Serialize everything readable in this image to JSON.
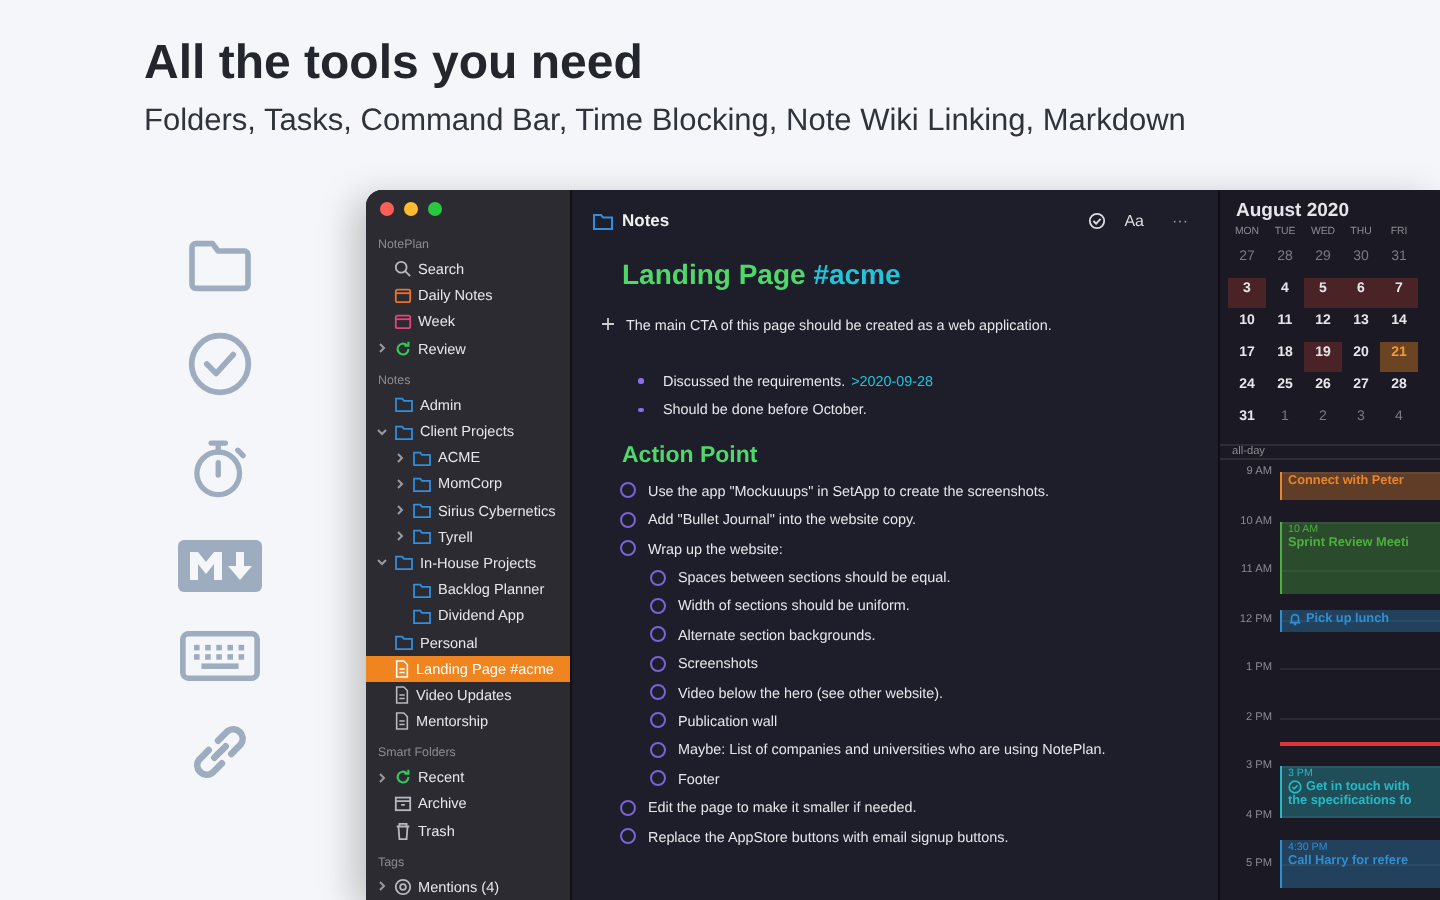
{
  "headline": "All the tools you need",
  "subheadline": "Folders, Tasks, Command Bar, Time Blocking, Note Wiki Linking, Markdown",
  "sidebar": {
    "sections": [
      {
        "title": "NotePlan",
        "items": [
          {
            "label": "Search",
            "kind": "search",
            "selected": false
          },
          {
            "label": "Daily Notes",
            "kind": "daily",
            "selected": false
          },
          {
            "label": "Week",
            "kind": "week",
            "selected": false
          },
          {
            "label": "Review",
            "kind": "review",
            "selected": false,
            "expanded": false
          }
        ]
      },
      {
        "title": "Notes",
        "items": [
          {
            "label": "Admin",
            "kind": "folder",
            "selected": false
          },
          {
            "label": "Client Projects",
            "kind": "folder",
            "selected": false,
            "expanded": true,
            "children": [
              {
                "label": "ACME",
                "kind": "folder",
                "selected": false,
                "expanded": false
              },
              {
                "label": "MomCorp",
                "kind": "folder",
                "selected": false,
                "expanded": false
              },
              {
                "label": "Sirius Cybernetics",
                "kind": "folder",
                "selected": false,
                "expanded": false
              },
              {
                "label": "Tyrell",
                "kind": "folder",
                "selected": false,
                "expanded": false
              }
            ]
          },
          {
            "label": "In-House Projects",
            "kind": "folder",
            "selected": false,
            "expanded": true,
            "children": [
              {
                "label": "Backlog Planner",
                "kind": "folder",
                "selected": false
              },
              {
                "label": "Dividend App",
                "kind": "folder",
                "selected": false
              }
            ]
          },
          {
            "label": "Personal",
            "kind": "folder",
            "selected": false
          },
          {
            "label": "Landing Page #acme",
            "kind": "note",
            "selected": true
          },
          {
            "label": "Video Updates",
            "kind": "note",
            "selected": false
          },
          {
            "label": "Mentorship",
            "kind": "note",
            "selected": false
          }
        ]
      },
      {
        "title": "Smart Folders",
        "items": [
          {
            "label": "Recent",
            "kind": "recent",
            "selected": false,
            "expanded": false
          },
          {
            "label": "Archive",
            "kind": "archive",
            "selected": false
          },
          {
            "label": "Trash",
            "kind": "trash",
            "selected": false
          }
        ]
      },
      {
        "title": "Tags",
        "items": [
          {
            "label": "Mentions (4)",
            "kind": "mention",
            "selected": false,
            "expanded": false
          }
        ]
      }
    ]
  },
  "editor": {
    "folder": "Notes",
    "font_button": "Aa",
    "more_button": "···",
    "title": {
      "text": "Landing Page",
      "tag": "#acme"
    },
    "lines": [
      {
        "kind": "note",
        "text": "The main CTA of this page should be created as a web application."
      },
      {
        "kind": "bullet",
        "text": "Discussed the requirements.",
        "link": ">2020-09-28"
      },
      {
        "kind": "bullet",
        "text": "Should be done before October."
      },
      {
        "kind": "heading",
        "text": "Action Point"
      },
      {
        "kind": "task",
        "text": "Use the app \"Mockuuups\" in SetApp to create the screenshots.",
        "checked": false
      },
      {
        "kind": "task",
        "text": "Add \"Bullet Journal\" into the website copy.",
        "checked": false
      },
      {
        "kind": "task",
        "text": "Wrap up the website:",
        "checked": false,
        "children": [
          {
            "kind": "task",
            "text": "Spaces between sections should be equal.",
            "checked": false
          },
          {
            "kind": "task",
            "text": "Width of sections should be uniform.",
            "checked": false
          },
          {
            "kind": "task",
            "text": "Alternate section backgrounds.",
            "checked": false
          },
          {
            "kind": "task",
            "text": "Screenshots",
            "checked": false
          },
          {
            "kind": "task",
            "text": "Video below the hero (see other website).",
            "checked": false
          },
          {
            "kind": "task",
            "text": "Publication wall",
            "checked": false
          },
          {
            "kind": "task",
            "text": "Maybe: List of companies and universities who are using NotePlan.",
            "checked": false
          },
          {
            "kind": "task",
            "text": "Footer",
            "checked": false
          }
        ]
      },
      {
        "kind": "task",
        "text": "Edit the page to make it smaller if needed.",
        "checked": false
      },
      {
        "kind": "task",
        "text": "Replace the AppStore buttons with email signup buttons.",
        "checked": false
      }
    ]
  },
  "calendar": {
    "month": "August 2020",
    "weekdays": [
      "MON",
      "TUE",
      "WED",
      "THU",
      "FRI"
    ],
    "weeks": [
      [
        {
          "day": "27",
          "muted": true,
          "marked": false,
          "selected": false
        },
        {
          "day": "28",
          "muted": true,
          "marked": false,
          "selected": false
        },
        {
          "day": "29",
          "muted": true,
          "marked": false,
          "selected": false
        },
        {
          "day": "30",
          "muted": true,
          "marked": false,
          "selected": false
        },
        {
          "day": "31",
          "muted": true,
          "marked": false,
          "selected": false
        }
      ],
      [
        {
          "day": "3",
          "muted": false,
          "marked": true,
          "selected": false
        },
        {
          "day": "4",
          "muted": false,
          "marked": false,
          "selected": false
        },
        {
          "day": "5",
          "muted": false,
          "marked": true,
          "selected": false
        },
        {
          "day": "6",
          "muted": false,
          "marked": true,
          "selected": false
        },
        {
          "day": "7",
          "muted": false,
          "marked": true,
          "selected": false
        }
      ],
      [
        {
          "day": "10",
          "muted": false,
          "marked": false,
          "selected": false
        },
        {
          "day": "11",
          "muted": false,
          "marked": false,
          "selected": false
        },
        {
          "day": "12",
          "muted": false,
          "marked": false,
          "selected": false
        },
        {
          "day": "13",
          "muted": false,
          "marked": false,
          "selected": false
        },
        {
          "day": "14",
          "muted": false,
          "marked": false,
          "selected": false
        }
      ],
      [
        {
          "day": "17",
          "muted": false,
          "marked": false,
          "selected": false
        },
        {
          "day": "18",
          "muted": false,
          "marked": false,
          "selected": false
        },
        {
          "day": "19",
          "muted": false,
          "marked": true,
          "selected": false
        },
        {
          "day": "20",
          "muted": false,
          "marked": false,
          "selected": false
        },
        {
          "day": "21",
          "muted": false,
          "marked": false,
          "selected": true
        }
      ],
      [
        {
          "day": "24",
          "muted": false,
          "marked": false,
          "selected": false
        },
        {
          "day": "25",
          "muted": false,
          "marked": false,
          "selected": false
        },
        {
          "day": "26",
          "muted": false,
          "marked": false,
          "selected": false
        },
        {
          "day": "27",
          "muted": false,
          "marked": false,
          "selected": false
        },
        {
          "day": "28",
          "muted": false,
          "marked": false,
          "selected": false
        }
      ],
      [
        {
          "day": "31",
          "muted": false,
          "marked": false,
          "selected": false
        },
        {
          "day": "1",
          "muted": true,
          "marked": false,
          "selected": false
        },
        {
          "day": "2",
          "muted": true,
          "marked": false,
          "selected": false
        },
        {
          "day": "3",
          "muted": true,
          "marked": false,
          "selected": false
        },
        {
          "day": "4",
          "muted": true,
          "marked": false,
          "selected": false
        }
      ]
    ],
    "all_day": "all-day",
    "hours": [
      "9 AM",
      "10 AM",
      "11 AM",
      "12 PM",
      "1 PM",
      "2 PM",
      "3 PM",
      "4 PM",
      "5 PM"
    ],
    "events": [
      {
        "kind": "event",
        "title": [
          "Connect with Peter"
        ],
        "color": "#e8842c"
      },
      {
        "kind": "event",
        "time": "10 AM",
        "title": [
          "Sprint Review Meeti"
        ],
        "color": "#4caf3f"
      },
      {
        "kind": "reminder",
        "title": [
          "Pick up lunch"
        ],
        "color": "#2f8fd0"
      },
      {
        "kind": "task",
        "time": "3 PM",
        "title": [
          "Get in touch with",
          "the specifications fo"
        ],
        "color": "#26b8c4"
      },
      {
        "kind": "event",
        "time": "4:30 PM",
        "title": [
          "Call Harry for refere"
        ],
        "color": "#2f8fd0"
      }
    ]
  }
}
